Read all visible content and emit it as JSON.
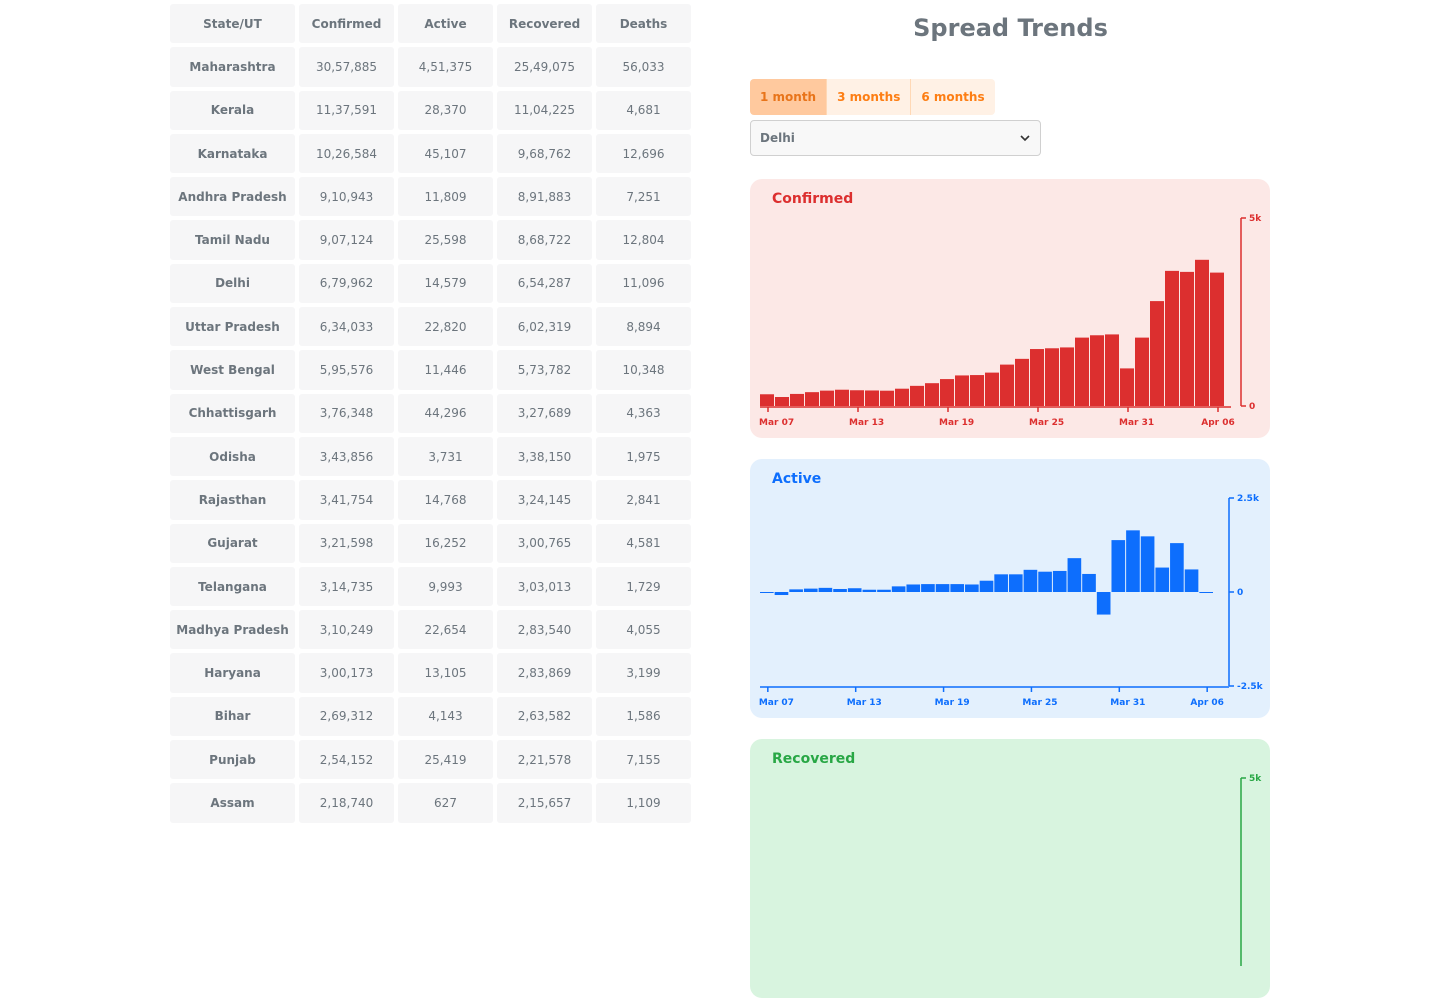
{
  "table": {
    "headers": [
      "State/UT",
      "Confirmed",
      "Active",
      "Recovered",
      "Deaths"
    ],
    "rows": [
      {
        "state": "Maharashtra",
        "confirmed": "30,57,885",
        "active": "4,51,375",
        "recovered": "25,49,075",
        "deaths": "56,033"
      },
      {
        "state": "Kerala",
        "confirmed": "11,37,591",
        "active": "28,370",
        "recovered": "11,04,225",
        "deaths": "4,681"
      },
      {
        "state": "Karnataka",
        "confirmed": "10,26,584",
        "active": "45,107",
        "recovered": "9,68,762",
        "deaths": "12,696"
      },
      {
        "state": "Andhra Pradesh",
        "confirmed": "9,10,943",
        "active": "11,809",
        "recovered": "8,91,883",
        "deaths": "7,251"
      },
      {
        "state": "Tamil Nadu",
        "confirmed": "9,07,124",
        "active": "25,598",
        "recovered": "8,68,722",
        "deaths": "12,804"
      },
      {
        "state": "Delhi",
        "confirmed": "6,79,962",
        "active": "14,579",
        "recovered": "6,54,287",
        "deaths": "11,096"
      },
      {
        "state": "Uttar Pradesh",
        "confirmed": "6,34,033",
        "active": "22,820",
        "recovered": "6,02,319",
        "deaths": "8,894"
      },
      {
        "state": "West Bengal",
        "confirmed": "5,95,576",
        "active": "11,446",
        "recovered": "5,73,782",
        "deaths": "10,348"
      },
      {
        "state": "Chhattisgarh",
        "confirmed": "3,76,348",
        "active": "44,296",
        "recovered": "3,27,689",
        "deaths": "4,363"
      },
      {
        "state": "Odisha",
        "confirmed": "3,43,856",
        "active": "3,731",
        "recovered": "3,38,150",
        "deaths": "1,975"
      },
      {
        "state": "Rajasthan",
        "confirmed": "3,41,754",
        "active": "14,768",
        "recovered": "3,24,145",
        "deaths": "2,841"
      },
      {
        "state": "Gujarat",
        "confirmed": "3,21,598",
        "active": "16,252",
        "recovered": "3,00,765",
        "deaths": "4,581"
      },
      {
        "state": "Telangana",
        "confirmed": "3,14,735",
        "active": "9,993",
        "recovered": "3,03,013",
        "deaths": "1,729"
      },
      {
        "state": "Madhya Pradesh",
        "confirmed": "3,10,249",
        "active": "22,654",
        "recovered": "2,83,540",
        "deaths": "4,055"
      },
      {
        "state": "Haryana",
        "confirmed": "3,00,173",
        "active": "13,105",
        "recovered": "2,83,869",
        "deaths": "3,199"
      },
      {
        "state": "Bihar",
        "confirmed": "2,69,312",
        "active": "4,143",
        "recovered": "2,63,582",
        "deaths": "1,586"
      },
      {
        "state": "Punjab",
        "confirmed": "2,54,152",
        "active": "25,419",
        "recovered": "2,21,578",
        "deaths": "7,155"
      },
      {
        "state": "Assam",
        "confirmed": "2,18,740",
        "active": "627",
        "recovered": "2,15,657",
        "deaths": "1,109"
      }
    ]
  },
  "trends": {
    "title": "Spread Trends",
    "period_tabs": [
      {
        "label": "1 month",
        "active": true
      },
      {
        "label": "3 months",
        "active": false
      },
      {
        "label": "6 months",
        "active": false
      }
    ],
    "selected_state": "Delhi",
    "icons": {
      "dropdown": "chevron-down-icon"
    }
  },
  "chart_data": [
    {
      "type": "bar",
      "title": "Confirmed",
      "color": "#dc2f2f",
      "x_ticks": [
        "Mar 07",
        "Mar 13",
        "Mar 19",
        "Mar 25",
        "Mar 31",
        "Apr 06"
      ],
      "y_ticks": [
        "0",
        "5k"
      ],
      "ylim": [
        0,
        5000
      ],
      "dates": [
        "Mar 06",
        "Mar 07",
        "Mar 08",
        "Mar 09",
        "Mar 10",
        "Mar 11",
        "Mar 12",
        "Mar 13",
        "Mar 14",
        "Mar 15",
        "Mar 16",
        "Mar 17",
        "Mar 18",
        "Mar 19",
        "Mar 20",
        "Mar 21",
        "Mar 22",
        "Mar 23",
        "Mar 24",
        "Mar 25",
        "Mar 26",
        "Mar 27",
        "Mar 28",
        "Mar 29",
        "Mar 30",
        "Mar 31",
        "Apr 01",
        "Apr 02",
        "Apr 03",
        "Apr 04",
        "Apr 05"
      ],
      "values": [
        312,
        239,
        321,
        368,
        409,
        433,
        419,
        413,
        407,
        460,
        536,
        607,
        716,
        813,
        823,
        888,
        1101,
        1254,
        1515,
        1535,
        1558,
        1819,
        1881,
        1904,
        1000,
        1819,
        2790,
        3594,
        3567,
        3888,
        3548
      ]
    },
    {
      "type": "bar",
      "title": "Active",
      "color": "#0d6efd",
      "x_ticks": [
        "Mar 07",
        "Mar 13",
        "Mar 19",
        "Mar 25",
        "Mar 31",
        "Apr 06"
      ],
      "y_ticks": [
        "-2.5k",
        "0",
        "2.5k"
      ],
      "ylim": [
        -2500,
        2500
      ],
      "dates": [
        "Mar 06",
        "Mar 07",
        "Mar 08",
        "Mar 09",
        "Mar 10",
        "Mar 11",
        "Mar 12",
        "Mar 13",
        "Mar 14",
        "Mar 15",
        "Mar 16",
        "Mar 17",
        "Mar 18",
        "Mar 19",
        "Mar 20",
        "Mar 21",
        "Mar 22",
        "Mar 23",
        "Mar 24",
        "Mar 25",
        "Mar 26",
        "Mar 27",
        "Mar 28",
        "Mar 29",
        "Mar 30",
        "Mar 31",
        "Apr 01",
        "Apr 02",
        "Apr 03",
        "Apr 04",
        "Apr 05"
      ],
      "values": [
        -20,
        -80,
        70,
        90,
        110,
        80,
        100,
        60,
        60,
        150,
        200,
        210,
        210,
        210,
        200,
        300,
        470,
        470,
        590,
        540,
        560,
        900,
        480,
        -600,
        1380,
        1640,
        1480,
        650,
        1300,
        600,
        0
      ]
    },
    {
      "type": "bar",
      "title": "Recovered",
      "color": "#28a745",
      "x_ticks": [],
      "y_ticks": [
        "5k"
      ],
      "ylim": [
        0,
        5000
      ],
      "values": []
    }
  ]
}
